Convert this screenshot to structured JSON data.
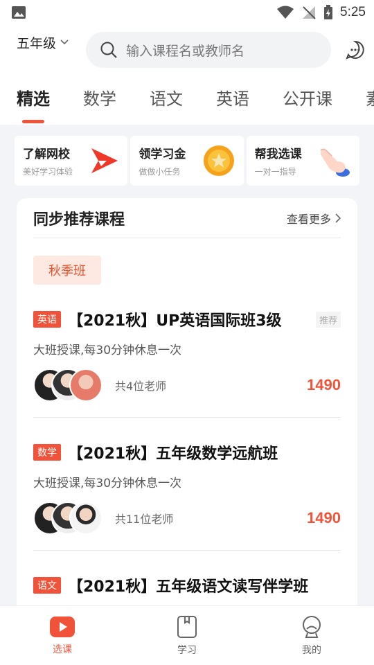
{
  "status": {
    "time": "5:25"
  },
  "header": {
    "grade": "五年级",
    "search_placeholder": "输入课程名或教师名"
  },
  "tabs": [
    {
      "label": "精选",
      "active": true
    },
    {
      "label": "数学"
    },
    {
      "label": "语文"
    },
    {
      "label": "英语"
    },
    {
      "label": "公开课"
    },
    {
      "label": "素"
    }
  ],
  "quick": [
    {
      "title": "了解网校",
      "sub": "美好学习体验",
      "icon": "play-logo-icon"
    },
    {
      "title": "领学习金",
      "sub": "做做小任务",
      "icon": "gold-coin-icon"
    },
    {
      "title": "帮我选课",
      "sub": "一对一指导",
      "icon": "pointing-hand-icon"
    }
  ],
  "section": {
    "title": "同步推荐课程",
    "more": "查看更多",
    "season": "秋季班"
  },
  "courses": [
    {
      "subject": "英语",
      "title": "【2021秋】UP英语国际班3级",
      "badge": "推荐",
      "desc": "大班授课,每30分钟休息一次",
      "teachers": "共4位老师",
      "price": "1490"
    },
    {
      "subject": "数学",
      "title": "【2021秋】五年级数学远航班",
      "badge": "",
      "desc": "大班授课,每30分钟休息一次",
      "teachers": "共11位老师",
      "price": "1490"
    },
    {
      "subject": "语文",
      "title": "【2021秋】五年级语文读写伴学班",
      "badge": "",
      "desc": "",
      "teachers": "",
      "price": ""
    }
  ],
  "nav": [
    {
      "label": "选课",
      "active": true
    },
    {
      "label": "学习"
    },
    {
      "label": "我的"
    }
  ],
  "colors": {
    "accent": "#f0533a",
    "background": "#f3f4f8"
  }
}
